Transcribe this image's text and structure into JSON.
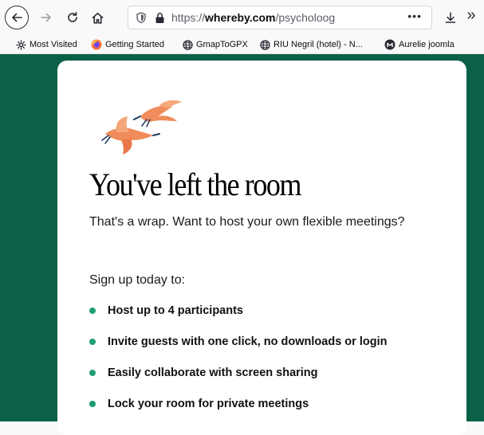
{
  "browser": {
    "url_host": "whereby.com",
    "url_path": "/psycholoog",
    "url_prefix": "https://",
    "more_label": "•••",
    "overflow_label": "»"
  },
  "bookmarks": [
    {
      "label": "Most Visited",
      "icon": "gear-icon"
    },
    {
      "label": "Getting Started",
      "icon": "firefox-icon"
    },
    {
      "label": "GmapToGPX",
      "icon": "globe-icon"
    },
    {
      "label": "RIU Negril (hotel) - N...",
      "icon": "globe-icon"
    },
    {
      "label": "Aurelie joomla",
      "icon": "joomla-icon"
    }
  ],
  "page": {
    "heading": "You've left the room",
    "intro": "That's a wrap. Want to host your own flexible meetings?",
    "signup_prompt": "Sign up today to:",
    "features": [
      "Host up to 4 participants",
      "Invite guests with one click, no downloads or login",
      "Easily collaborate with screen sharing",
      "Lock your room for private meetings"
    ]
  },
  "colors": {
    "background": "#0b6148",
    "accent": "#1e9e6f",
    "bird": "#f08c5a",
    "card": "#ffffff"
  }
}
